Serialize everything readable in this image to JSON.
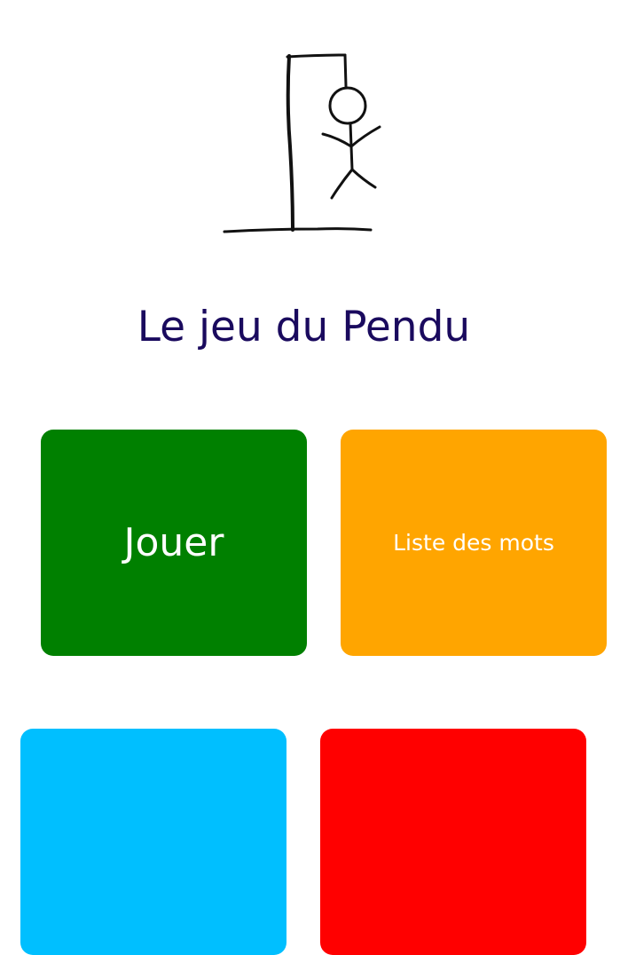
{
  "title": "Le jeu du Pendu",
  "buttons": {
    "play_label": "Jouer",
    "words_label": "Liste des mots"
  },
  "colors": {
    "title": "#1a0a5e",
    "play": "#008000",
    "words": "#ffa500",
    "blue_tile": "#00bfff",
    "red_tile": "#ff0000"
  },
  "icons": {
    "logo": "hangman-icon"
  }
}
